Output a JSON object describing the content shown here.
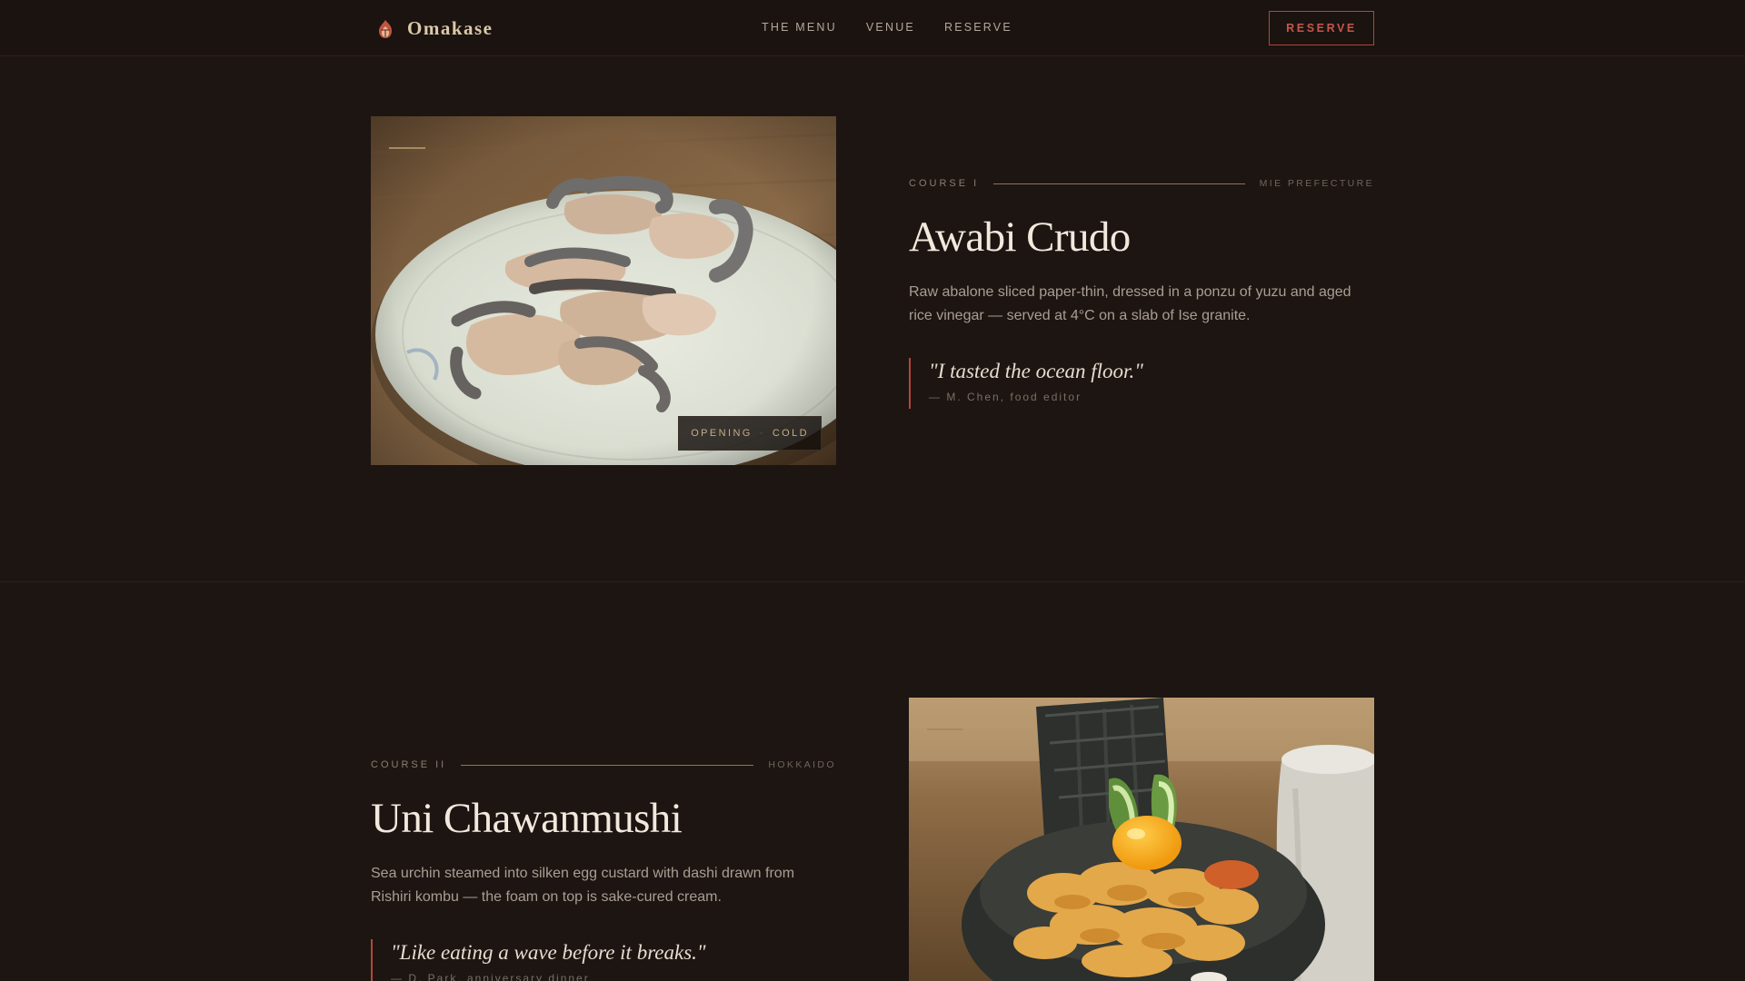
{
  "nav": {
    "brand": "Omakase",
    "links": [
      "THE MENU",
      "VENUE",
      "RESERVE"
    ],
    "cta": "RESERVE"
  },
  "courses": [
    {
      "course_label": "COURSE I",
      "origin": "MIE PREFECTURE",
      "name": "Awabi Crudo",
      "description": "Raw abalone sliced paper-thin, dressed in a ponzu of yuzu and aged rice vinegar — served at 4°C on a slab of Ise granite.",
      "quote": "\"I tasted the ocean floor.\"",
      "attribution": "— M. Chen, food editor",
      "tag_service": "OPENING",
      "tag_temp": "COLD"
    },
    {
      "course_label": "COURSE II",
      "origin": "HOKKAIDO",
      "name": "Uni Chawanmushi",
      "description": "Sea urchin steamed into silken egg custard with dashi drawn from Rishiri kombu — the foam on top is sake-cured cream.",
      "quote": "\"Like eating a wave before it breaks.\"",
      "attribution": "— D. Park, anniversary dinner"
    }
  ],
  "colors": {
    "background": "#1d1511",
    "accent": "#b3473a",
    "gold": "#dcc9a8"
  },
  "icons": [
    "flame-logo-icon"
  ]
}
